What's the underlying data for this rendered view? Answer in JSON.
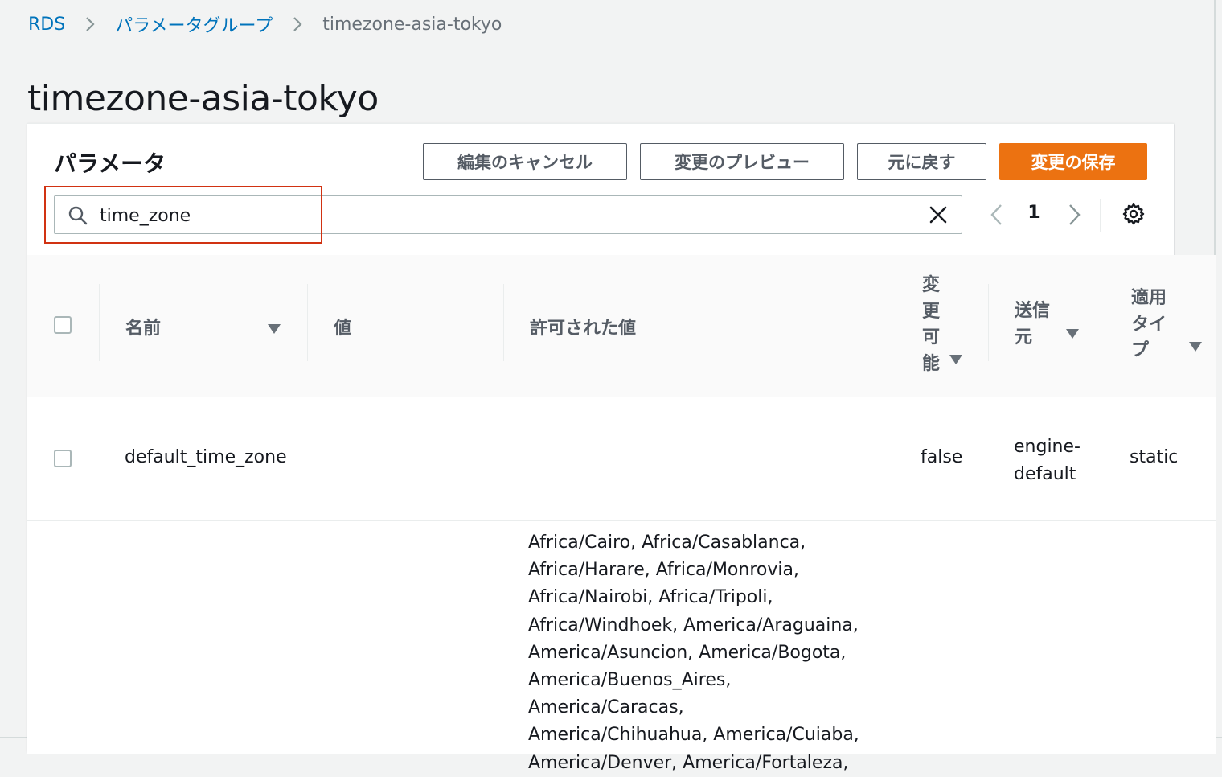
{
  "breadcrumb": {
    "items": [
      {
        "label": "RDS"
      },
      {
        "label": "パラメータグループ"
      }
    ],
    "current": "timezone-asia-tokyo"
  },
  "page": {
    "title": "timezone-asia-tokyo"
  },
  "panel": {
    "title": "パラメータ",
    "buttons": {
      "cancel_edit": "編集のキャンセル",
      "preview_changes": "変更のプレビュー",
      "reset": "元に戻す",
      "save_changes": "変更の保存"
    },
    "search": {
      "value": "time_zone"
    },
    "pagination": {
      "current_page": "1"
    }
  },
  "table": {
    "columns": {
      "name": "名前",
      "value": "値",
      "allowed_values": "許可された値",
      "modifiable": [
        "変",
        "更",
        "可",
        "能"
      ],
      "source": [
        "送信",
        "元"
      ],
      "apply_type": [
        "適用",
        "タイ",
        "プ"
      ]
    },
    "rows": [
      {
        "name": "default_time_zone",
        "value": "",
        "allowed_values": "",
        "modifiable": "false",
        "source": [
          "engine-",
          "default"
        ],
        "apply_type": "static"
      }
    ],
    "partial_row": {
      "allowed_values_lines": [
        "Africa/Cairo, Africa/Casablanca,",
        "Africa/Harare, Africa/Monrovia,",
        "Africa/Nairobi, Africa/Tripoli,",
        "Africa/Windhoek, America/Araguaina,",
        "America/Asuncion, America/Bogota,",
        "America/Buenos_Aires, America/Caracas,",
        "America/Chihuahua, America/Cuiaba,",
        "America/Denver, America/Fortaleza,"
      ]
    }
  },
  "colors": {
    "accent": "#ec7211",
    "link": "#0073bb",
    "highlight": "#d13212",
    "background": "#f2f3f3"
  }
}
